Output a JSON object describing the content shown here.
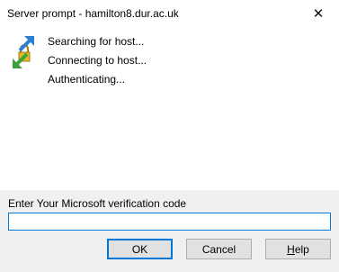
{
  "window": {
    "title": "Server prompt - hamilton8.dur.ac.uk",
    "close_glyph": "✕"
  },
  "status": {
    "icon": "network-connect-icon",
    "lines": [
      "Searching for host...",
      "Connecting to host...",
      "Authenticating..."
    ]
  },
  "prompt": {
    "label": "Enter Your Microsoft verification code",
    "value": "",
    "placeholder": ""
  },
  "buttons": {
    "ok": "OK",
    "cancel": "Cancel",
    "help_prefix": "H",
    "help_rest": "elp"
  },
  "colors": {
    "focus_border": "#0078d7",
    "button_bg": "#e1e1e1",
    "footer_bg": "#f0f0f0"
  }
}
